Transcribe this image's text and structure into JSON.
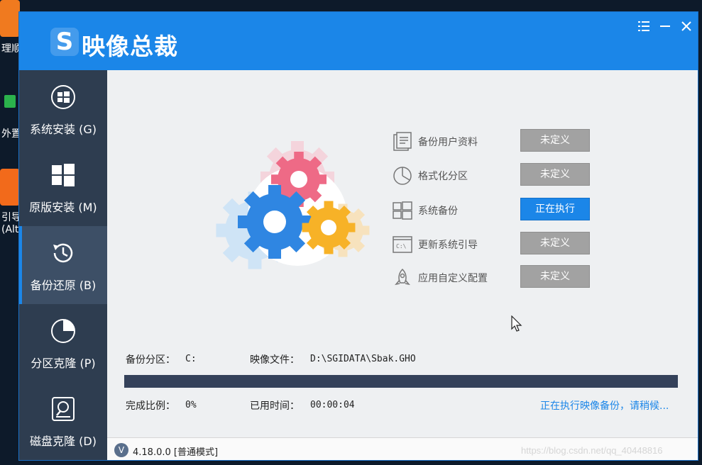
{
  "desktop": {
    "icons": [
      {
        "label": "理顺",
        "color": "#f07a1f"
      },
      {
        "label": "外置",
        "color": "#2bb24c"
      },
      {
        "label": "引导",
        "label2": "(Alt",
        "color": "#f26a1b"
      }
    ]
  },
  "window": {
    "title": "映像总裁",
    "logo_letter": "S"
  },
  "sidebar": {
    "items": [
      {
        "label": "系统安装 (G)",
        "icon": "windows-circle-icon"
      },
      {
        "label": "原版安装 (M)",
        "icon": "windows-logo-icon"
      },
      {
        "label": "备份还原 (B)",
        "icon": "clock-restore-icon",
        "active": true
      },
      {
        "label": "分区克隆 (P)",
        "icon": "pie-chart-icon"
      },
      {
        "label": "磁盘克隆 (D)",
        "icon": "disk-icon"
      }
    ]
  },
  "steps": [
    {
      "label": "备份用户资料",
      "status": "未定义",
      "icon": "document-icon"
    },
    {
      "label": "格式化分区",
      "status": "未定义",
      "icon": "pie-chart-icon"
    },
    {
      "label": "系统备份",
      "status": "正在执行",
      "icon": "windows-logo-icon",
      "running": true
    },
    {
      "label": "更新系统引导",
      "status": "未定义",
      "icon": "console-icon"
    },
    {
      "label": "应用自定义配置",
      "status": "未定义",
      "icon": "rocket-icon"
    }
  ],
  "info": {
    "partition_label": "备份分区：",
    "partition_value": "C:",
    "image_label": "映像文件：",
    "image_value": "D:\\SGIDATA\\Sbak.GHO",
    "progress_label": "完成比例：",
    "progress_value": "0%",
    "progress_fraction": 0,
    "time_label": "已用时间：",
    "time_value": "00:00:04",
    "status_text": "正在执行映像备份，请稍候..."
  },
  "statusbar": {
    "version_badge": "V",
    "version_text": "4.18.0.0 [普通模式]"
  },
  "watermark": "https://blog.csdn.net/qq_40448816",
  "colors": {
    "accent": "#1b86e8",
    "sidebar": "#2e3d50",
    "idle_button": "#a2a2a2"
  }
}
